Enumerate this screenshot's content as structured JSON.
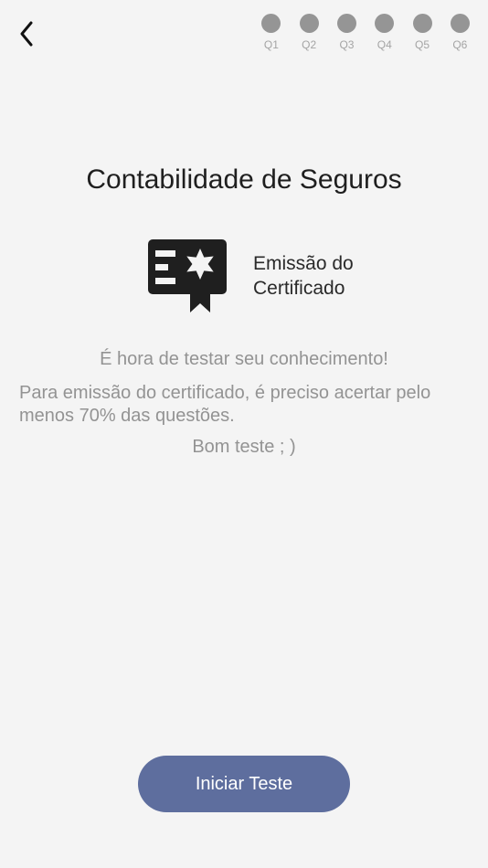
{
  "header": {
    "back_icon": "chevron-left-icon",
    "steps": [
      {
        "label": "Q1"
      },
      {
        "label": "Q2"
      },
      {
        "label": "Q3"
      },
      {
        "label": "Q4"
      },
      {
        "label": "Q5"
      },
      {
        "label": "Q6"
      }
    ]
  },
  "main": {
    "title": "Contabilidade de Seguros",
    "certificate": {
      "icon": "certificate-icon",
      "label_line1": "Emissão do",
      "label_line2": "Certificado"
    },
    "message": {
      "heading": "É hora de testar seu conhecimento!",
      "body": "Para emissão do certificado, é preciso acertar pelo menos 70% das questões.",
      "footer": "Bom teste ; )"
    }
  },
  "footer": {
    "start_button_label": "Iniciar Teste"
  },
  "colors": {
    "background": "#f4f4f4",
    "step_dot": "#959595",
    "button": "#5e6e9e",
    "muted_text": "#939393"
  }
}
